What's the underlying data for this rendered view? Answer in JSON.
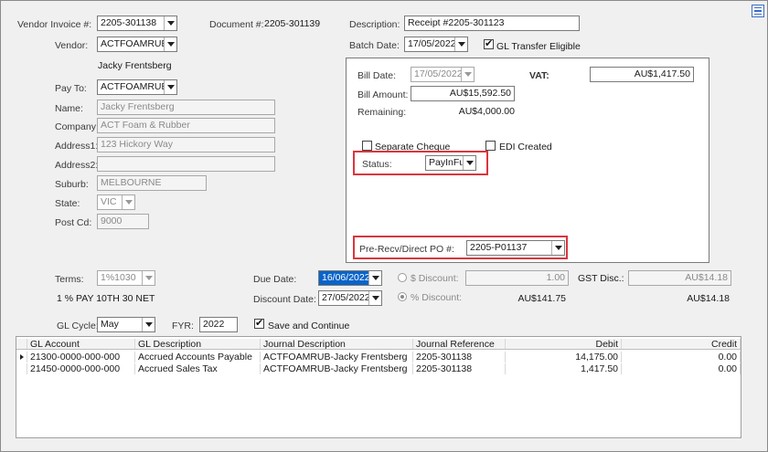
{
  "vendor_invoice": {
    "label": "Vendor Invoice #:",
    "value": "2205-301138"
  },
  "document": {
    "label": "Document #:",
    "value": "2205-301139"
  },
  "description": {
    "label": "Description:",
    "value": "Receipt #2205-301123"
  },
  "vendor": {
    "label": "Vendor:",
    "value": "ACTFOAMRUB",
    "name": "Jacky Frentsberg"
  },
  "batch_date": {
    "label": "Batch Date:",
    "value": "17/05/2022"
  },
  "gl_transfer": {
    "label": "GL Transfer Eligible",
    "checked": true
  },
  "pay_to": {
    "label": "Pay To:",
    "value": "ACTFOAMRUB"
  },
  "name": {
    "label": "Name:",
    "value": "Jacky Frentsberg"
  },
  "company": {
    "label": "Company:",
    "value": "ACT Foam & Rubber"
  },
  "address1": {
    "label": "Address1:",
    "value": "123 Hickory Way"
  },
  "address2": {
    "label": "Address2:",
    "value": ""
  },
  "suburb": {
    "label": "Suburb:",
    "value": "MELBOURNE"
  },
  "state": {
    "label": "State:",
    "value": "VIC"
  },
  "post_cd": {
    "label": "Post Cd:",
    "value": "9000"
  },
  "bill_date": {
    "label": "Bill Date:",
    "value": "17/05/2022"
  },
  "vat": {
    "label": "VAT:",
    "value": "AU$1,417.50"
  },
  "bill_amount": {
    "label": "Bill Amount:",
    "value": "AU$15,592.50"
  },
  "remaining": {
    "label": "Remaining:",
    "value": "AU$4,000.00"
  },
  "separate_cheque": {
    "label": "Separate Cheque",
    "checked": false
  },
  "edi_created": {
    "label": "EDI Created",
    "checked": false
  },
  "status": {
    "label": "Status:",
    "value": "PayInFull"
  },
  "pre_recv_po": {
    "label": "Pre-Recv/Direct PO #:",
    "value": "2205-P01137"
  },
  "terms": {
    "label": "Terms:",
    "value": "1%1030",
    "description": "1 % PAY 10TH 30 NET"
  },
  "due_date": {
    "label": "Due Date:",
    "value": "16/06/2022"
  },
  "discount_date": {
    "label": "Discount Date:",
    "value": "27/05/2022"
  },
  "dollar_discount": {
    "label": "$ Discount:",
    "value": "1.00"
  },
  "pct_discount": {
    "label": "% Discount:",
    "value": "AU$141.75"
  },
  "gst_disc": {
    "label": "GST Disc.:",
    "value": "AU$14.18",
    "value2": "AU$14.18"
  },
  "gl_cycle": {
    "label": "GL Cycle:",
    "value": "May"
  },
  "fyr": {
    "label": "FYR:",
    "value": "2022"
  },
  "save_continue": {
    "label": "Save and Continue",
    "checked": true
  },
  "grid": {
    "columns": [
      "GL Account",
      "GL Description",
      "Journal Description",
      "Journal Reference",
      "Debit",
      "Credit"
    ],
    "rows": [
      [
        "21300-0000-000-000",
        "Accrued Accounts Payable",
        "ACTFOAMRUB-Jacky Frentsberg",
        "2205-301138",
        "14,175.00",
        "0.00"
      ],
      [
        "21450-0000-000-000",
        "Accrued Sales Tax",
        "ACTFOAMRUB-Jacky Frentsberg",
        "2205-301138",
        "1,417.50",
        "0.00"
      ]
    ]
  },
  "icons": {
    "menu": "hamburger-menu-icon",
    "row_pointer": "row-pointer-icon"
  },
  "colors": {
    "highlight_red": "#d9363e",
    "selection_blue": "#0a64c8"
  }
}
